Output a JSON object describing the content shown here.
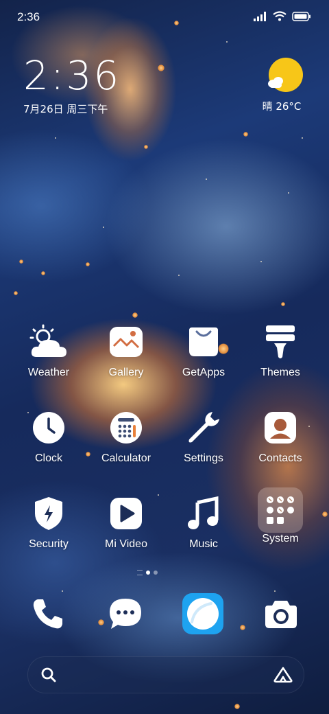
{
  "status_bar": {
    "time": "2:36"
  },
  "clock_widget": {
    "time": "2:36",
    "date": "7月26日 周三下午"
  },
  "weather_widget": {
    "temp": "晴 26°C",
    "icon": "sun-cloud-icon"
  },
  "apps": [
    {
      "label": "Weather",
      "icon": "weather-icon"
    },
    {
      "label": "Gallery",
      "icon": "gallery-icon"
    },
    {
      "label": "GetApps",
      "icon": "getapps-icon"
    },
    {
      "label": "Themes",
      "icon": "themes-icon"
    },
    {
      "label": "Clock",
      "icon": "clock-icon"
    },
    {
      "label": "Calculator",
      "icon": "calculator-icon"
    },
    {
      "label": "Settings",
      "icon": "settings-icon"
    },
    {
      "label": "Contacts",
      "icon": "contacts-icon"
    },
    {
      "label": "Security",
      "icon": "security-icon"
    },
    {
      "label": "Mi Video",
      "icon": "mi-video-icon"
    },
    {
      "label": "Music",
      "icon": "music-icon"
    },
    {
      "label": "System",
      "icon": "system-folder-icon"
    }
  ],
  "dock": [
    {
      "icon": "phone-icon"
    },
    {
      "icon": "messages-icon"
    },
    {
      "icon": "browser-icon"
    },
    {
      "icon": "camera-icon"
    }
  ],
  "search_bar": {
    "left_icon": "search-icon",
    "right_icon": "assistant-icon"
  },
  "colors": {
    "accent_sun": "#f7c618",
    "browser_blue": "#1ea3f0"
  }
}
